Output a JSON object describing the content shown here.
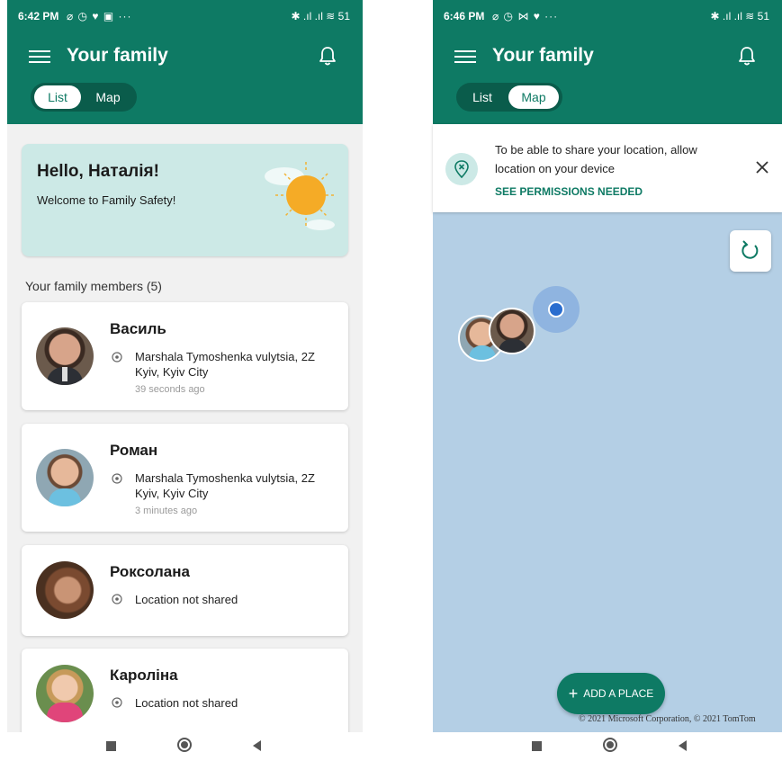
{
  "left_screen": {
    "status_bar": {
      "time": "6:42 PM",
      "icons": "⌀ ◷ ♥ ▣ ···",
      "right": "✱ .ıl .ıl ≋ 51"
    },
    "app_title": "Your family",
    "view_toggle": {
      "list_label": "List",
      "map_label": "Map",
      "selected": "List"
    },
    "welcome_card": {
      "greeting": "Hello, Наталія!",
      "subtitle": "Welcome to Family Safety!"
    },
    "members_header": "Your family members (5)",
    "members": [
      {
        "name": "Василь",
        "address_line1": "Marshala Tymoshenka vulytsia, 2Z",
        "address_line2": "Kyiv, Kyiv City",
        "last_seen": "39 seconds ago"
      },
      {
        "name": "Роман",
        "address_line1": "Marshala Tymoshenka vulytsia, 2Z",
        "address_line2": "Kyiv, Kyiv City",
        "last_seen": "3 minutes ago"
      },
      {
        "name": "Роксолана",
        "location_status": "Location not shared"
      },
      {
        "name": "Кароліна",
        "location_status": "Location not shared"
      }
    ]
  },
  "right_screen": {
    "status_bar": {
      "time": "6:46 PM",
      "icons": "⌀ ◷ ⋈ ♥ ···",
      "right": "✱ .ıl .ıl ≋ 51"
    },
    "app_title": "Your family",
    "view_toggle": {
      "list_label": "List",
      "map_label": "Map",
      "selected": "Map"
    },
    "permission_banner": {
      "message": "To be able to share your location, allow location on your device",
      "action_label": "SEE PERMISSIONS NEEDED"
    },
    "add_place_label": "ADD A PLACE",
    "map_copyright": "© 2021 Microsoft Corporation, © 2021 TomTom"
  },
  "colors": {
    "brand_green": "#0e7a64",
    "map_water": "#b4cfe5",
    "welcome_card": "#cce9e6",
    "location_dot": "#2a6dcf"
  },
  "icons": [
    "hamburger-menu-icon",
    "bell-icon",
    "sun-icon",
    "location-pin-icon",
    "location-off-icon",
    "close-icon",
    "refresh-icon",
    "plus-icon",
    "nav-recents-icon",
    "nav-home-icon",
    "nav-back-icon"
  ]
}
